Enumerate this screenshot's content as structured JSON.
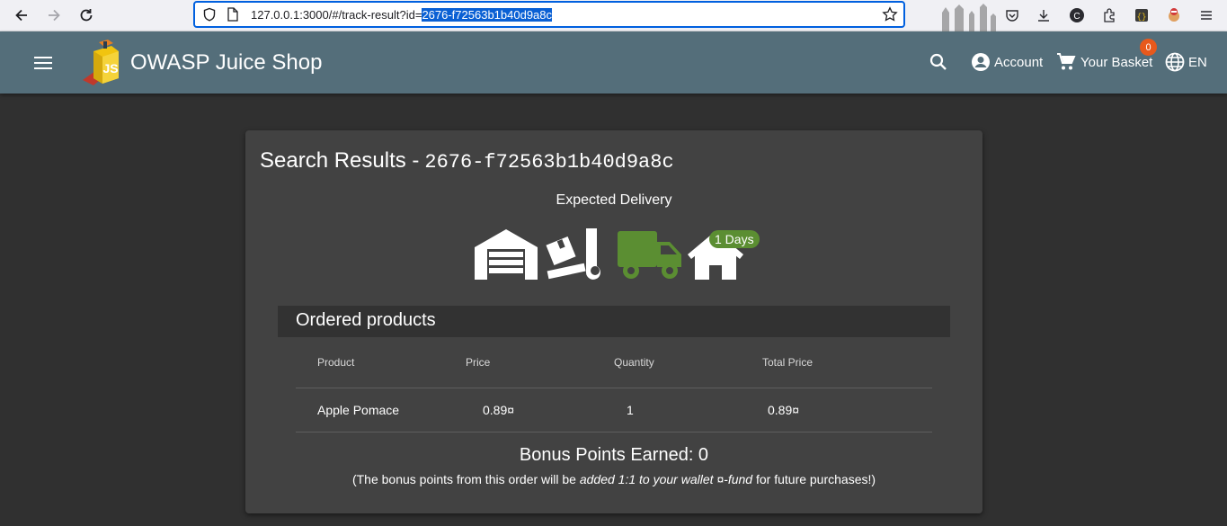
{
  "browser": {
    "url_prefix": "127.0.0.1:3000/#/track-result?id=",
    "url_selected": "2676-f72563b1b40d9a8c"
  },
  "toolbar": {
    "app_title": "OWASP Juice Shop",
    "account_label": "Account",
    "basket_label": "Your Basket",
    "basket_count": "0",
    "language_label": "EN"
  },
  "tracking": {
    "title_prefix": "Search Results -",
    "order_id": "2676-f72563b1b40d9a8c",
    "expected_delivery_label": "Expected Delivery",
    "days_label": "1 Days"
  },
  "products": {
    "section_title": "Ordered products",
    "columns": [
      "Product",
      "Price",
      "Quantity",
      "Total Price"
    ],
    "rows": [
      {
        "product": "Apple Pomace",
        "price": "0.89¤",
        "quantity": "1",
        "total": "0.89¤"
      }
    ]
  },
  "bonus": {
    "earned_text": "Bonus Points Earned: 0",
    "note_start": "(The bonus points from this order will be ",
    "note_emph": "added 1:1 to your wallet ¤-fund",
    "note_end": " for future purchases!)"
  },
  "colors": {
    "toolbar": "#546e7a",
    "background": "#303030",
    "card": "#424242",
    "accent_green": "#5b8e32",
    "badge": "#e8591c"
  }
}
